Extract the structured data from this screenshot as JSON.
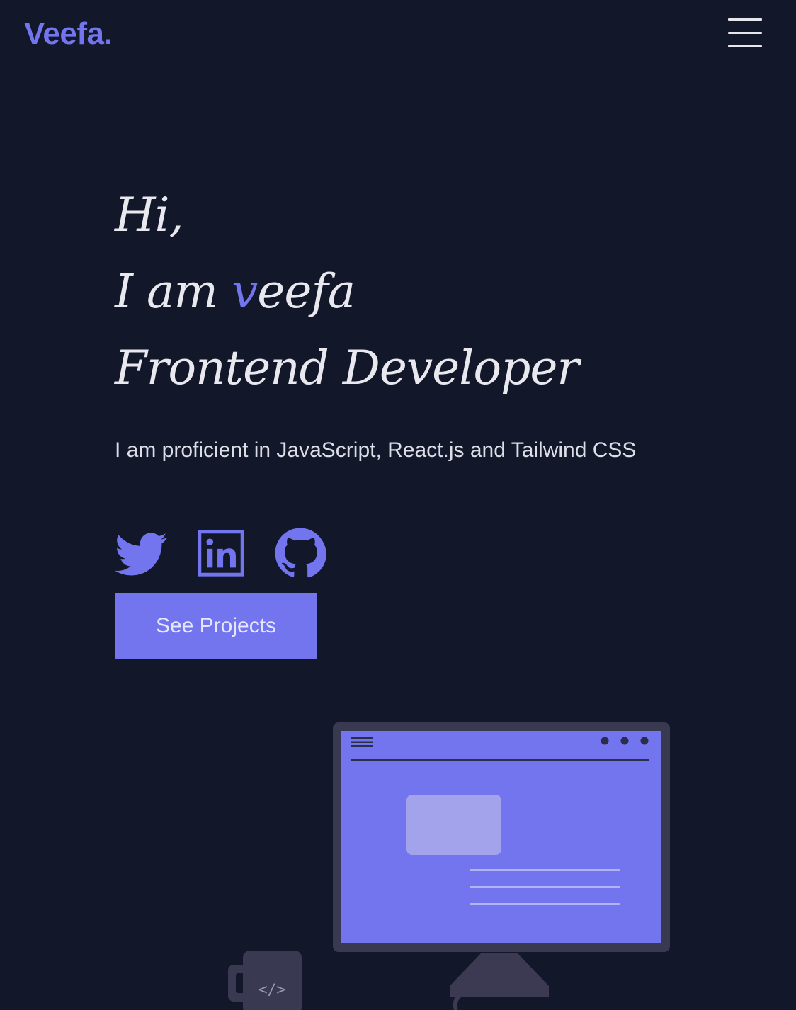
{
  "header": {
    "logo": "Veefa.",
    "menu_icon": "hamburger-menu-icon"
  },
  "hero": {
    "greeting": "Hi,",
    "intro_prefix": "I am ",
    "name_accent": "v",
    "name_rest": "eefa",
    "role": "Frontend Developer",
    "tagline": "I am proficient in JavaScript, React.js and Tailwind CSS",
    "cta_label": "See Projects"
  },
  "socials": [
    {
      "icon": "twitter-icon"
    },
    {
      "icon": "linkedin-icon"
    },
    {
      "icon": "github-icon"
    }
  ],
  "illustration": {
    "code_mug_text": "</>"
  },
  "colors": {
    "background": "#12172a",
    "accent": "#7375ee",
    "text": "#e8e8ee"
  }
}
